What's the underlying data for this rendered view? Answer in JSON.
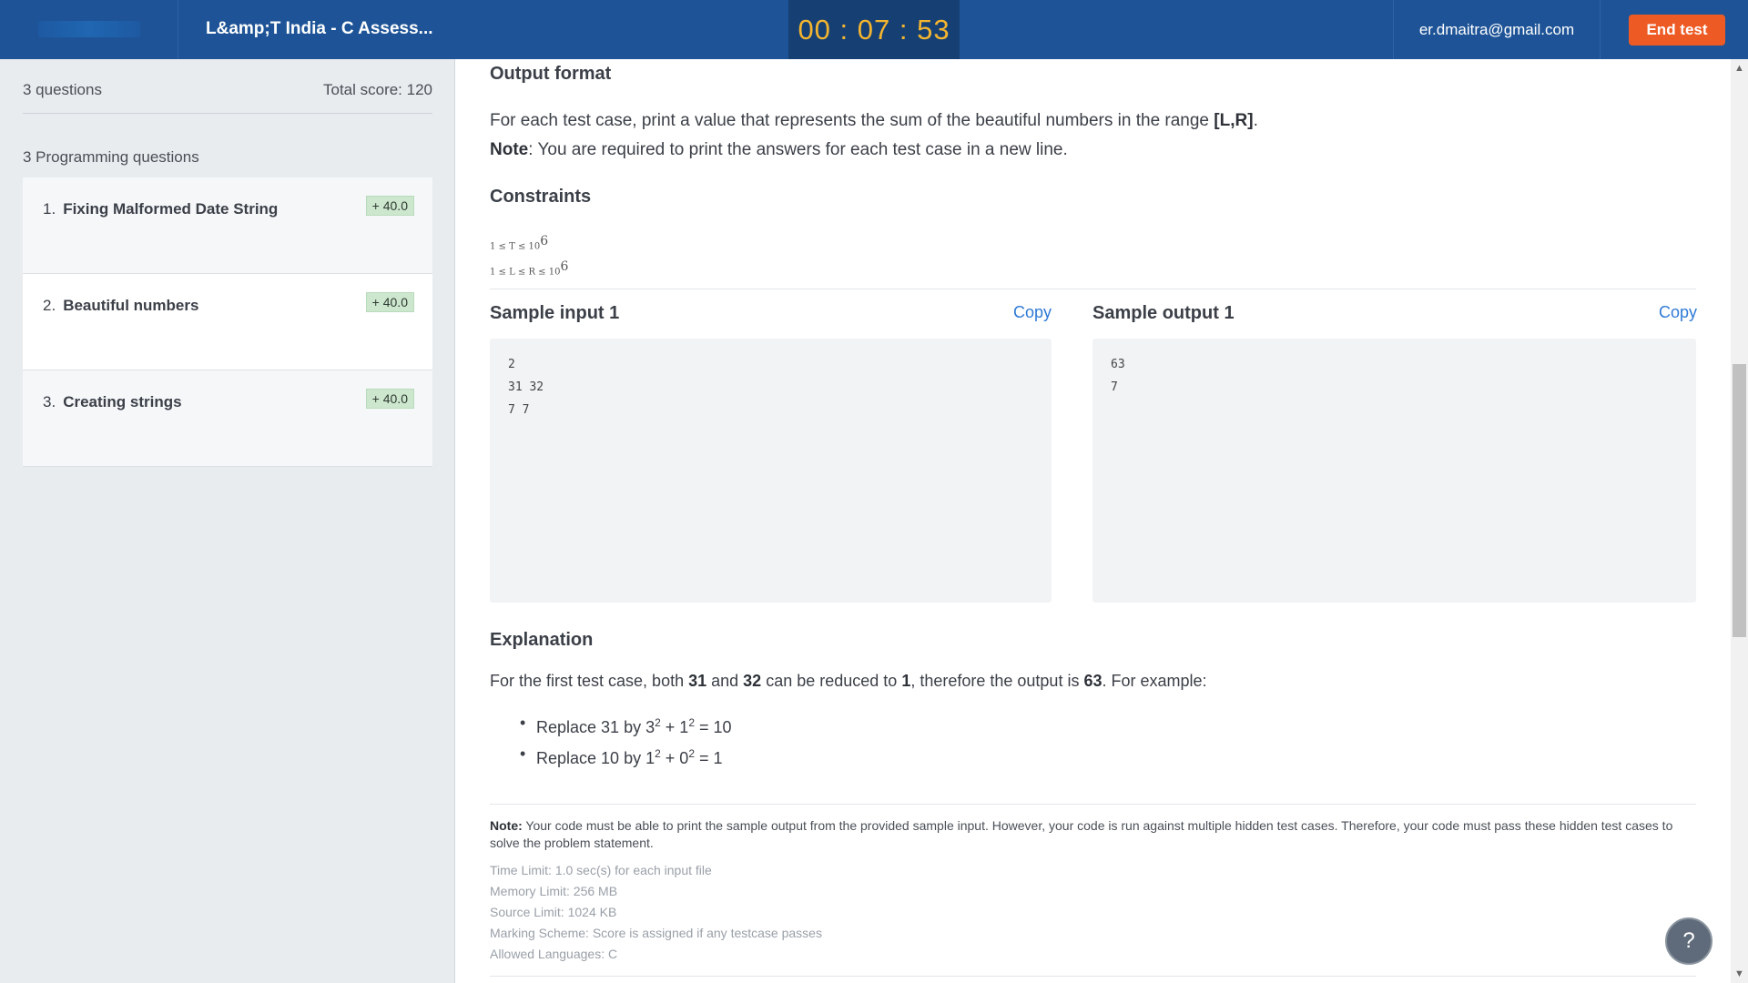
{
  "header": {
    "test_title": "L&amp;T India - C Assess...",
    "timer": "00 : 07 : 53",
    "user_email": "er.dmaitra@gmail.com",
    "end_test_label": "End test"
  },
  "sidebar": {
    "question_count": "3 questions",
    "total_score": "Total score: 120",
    "group_label": "3 Programming questions",
    "questions": [
      {
        "number": "1.",
        "title": "Fixing Malformed Date String",
        "score": "+ 40.0"
      },
      {
        "number": "2.",
        "title": "Beautiful numbers",
        "score": "+ 40.0"
      },
      {
        "number": "3.",
        "title": "Creating strings",
        "score": "+ 40.0"
      }
    ]
  },
  "problem": {
    "output_format_heading": "Output format",
    "output_line1_pre": "For each test case, print a value that represents the sum of the beautiful numbers in the range ",
    "output_line1_range": "[L,R]",
    "output_line1_post": ".",
    "output_note_label": "Note",
    "output_note_text": ": You are required to print the answers for each test case in a new line.",
    "constraints_heading": "Constraints",
    "constraint1": "1 ≤ T ≤ 10",
    "constraint1_exp": "6",
    "constraint2": "1 ≤ L ≤ R ≤ 10",
    "constraint2_exp": "6",
    "sample_input_title": "Sample input 1",
    "sample_output_title": "Sample output 1",
    "copy_label": "Copy",
    "sample_input_lines": [
      "2",
      "31 32",
      "7 7"
    ],
    "sample_output_lines": [
      "63",
      "7"
    ],
    "explanation_heading": "Explanation",
    "expl_t1": "For the first test case, both ",
    "expl_b1": "31",
    "expl_t2": " and ",
    "expl_b2": "32",
    "expl_t3": " can be reduced to ",
    "expl_b3": "1",
    "expl_t4": ", therefore the output is ",
    "expl_b4": "63",
    "expl_t5": ". For example:",
    "bullet1_a": "Replace 31 by 3",
    "bullet1_sup1": "2",
    "bullet1_b": " + 1",
    "bullet1_sup2": "2",
    "bullet1_c": "  = 10",
    "bullet2_a": "Replace 10 by 1",
    "bullet2_sup1": "2",
    "bullet2_b": " +  0",
    "bullet2_sup2": "2",
    "bullet2_c": " = 1",
    "note_label": "Note:",
    "note_text": " Your code must be able to print the sample output from the provided sample input. However, your code is run against multiple hidden test cases. Therefore, your code must pass these hidden test cases to solve the problem statement.",
    "limits": [
      "Time Limit: 1.0 sec(s) for each input file",
      "Memory Limit: 256 MB",
      "Source Limit: 1024 KB",
      "Marking Scheme: Score is assigned if any testcase passes",
      "Allowed Languages: C"
    ]
  },
  "help_label": "?",
  "colors": {
    "header": "#1e5497",
    "timer_bg": "#163f73",
    "timer_text": "#f3b530",
    "end_button": "#ee5a24",
    "link": "#2f7ad6",
    "score_badge": "#cde7cf"
  }
}
